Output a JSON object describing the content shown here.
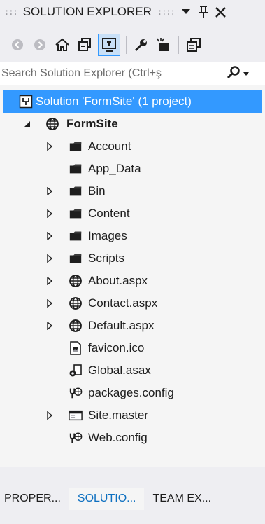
{
  "titlebar": {
    "title": "SOLUTION EXPLORER",
    "icons": [
      "grip-icon",
      "dropdown-arrow-icon",
      "pin-icon",
      "close-icon"
    ]
  },
  "toolbar": {
    "icons": [
      "back-icon",
      "forward-icon",
      "home-icon",
      "collapse-all-icon",
      "sync-view-icon",
      "properties-icon",
      "pending-changes-filter-icon",
      "preview-icon"
    ]
  },
  "search": {
    "placeholder": "Search Solution Explorer (Ctrl+ş"
  },
  "tree": {
    "solution_label": "Solution 'FormSite' (1 project)",
    "project_label": "FormSite",
    "items": [
      {
        "label": "Account",
        "icon": "folder-icon",
        "expandable": true
      },
      {
        "label": "App_Data",
        "icon": "folder-icon",
        "expandable": false
      },
      {
        "label": "Bin",
        "icon": "folder-icon",
        "expandable": true
      },
      {
        "label": "Content",
        "icon": "folder-icon",
        "expandable": true
      },
      {
        "label": "Images",
        "icon": "folder-icon",
        "expandable": true
      },
      {
        "label": "Scripts",
        "icon": "folder-icon",
        "expandable": true
      },
      {
        "label": "About.aspx",
        "icon": "globe-icon",
        "expandable": true
      },
      {
        "label": "Contact.aspx",
        "icon": "globe-icon",
        "expandable": true
      },
      {
        "label": "Default.aspx",
        "icon": "globe-icon",
        "expandable": true
      },
      {
        "label": "favicon.ico",
        "icon": "image-file-icon",
        "expandable": false
      },
      {
        "label": "Global.asax",
        "icon": "global-asax-icon",
        "expandable": false
      },
      {
        "label": "packages.config",
        "icon": "config-icon",
        "expandable": false
      },
      {
        "label": "Site.master",
        "icon": "master-page-icon",
        "expandable": true
      },
      {
        "label": "Web.config",
        "icon": "config-icon",
        "expandable": false
      }
    ]
  },
  "tabs": [
    {
      "label": "PROPER...",
      "active": false
    },
    {
      "label": "SOLUTIO...",
      "active": true
    },
    {
      "label": "TEAM EX...",
      "active": false
    }
  ],
  "colors": {
    "panel_bg": "#eeeef2",
    "tree_bg": "#f5f5f5",
    "selection": "#3399ff",
    "active_tab_text": "#0e70c0"
  }
}
